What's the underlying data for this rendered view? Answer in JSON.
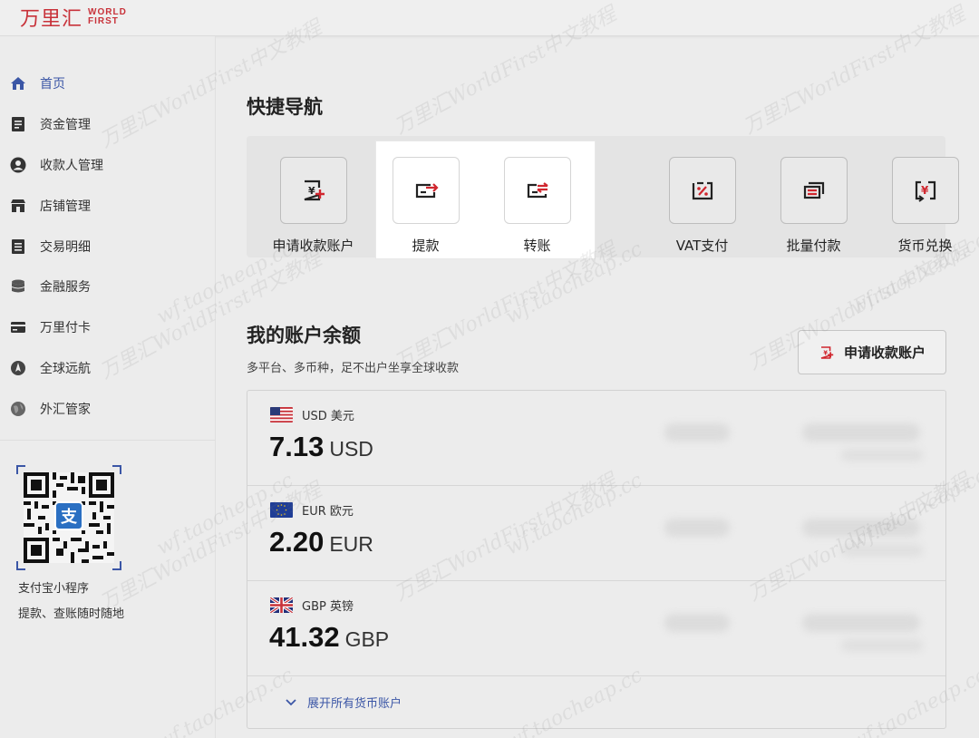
{
  "brand": {
    "logo_cn": "万里汇",
    "logo_en_line1": "WORLD",
    "logo_en_line2": "FIRST"
  },
  "sidebar": {
    "items": [
      {
        "label": "首页",
        "icon": "home-icon",
        "active": true
      },
      {
        "label": "资金管理",
        "icon": "document-icon",
        "active": false
      },
      {
        "label": "收款人管理",
        "icon": "user-icon",
        "active": false
      },
      {
        "label": "店铺管理",
        "icon": "store-icon",
        "active": false
      },
      {
        "label": "交易明细",
        "icon": "list-icon",
        "active": false
      },
      {
        "label": "金融服务",
        "icon": "database-icon",
        "active": false
      },
      {
        "label": "万里付卡",
        "icon": "card-icon",
        "active": false
      },
      {
        "label": "全球远航",
        "icon": "compass-icon",
        "active": false
      },
      {
        "label": "外汇管家",
        "icon": "globe-icon",
        "active": false
      }
    ],
    "qr_caption_1": "支付宝小程序",
    "qr_caption_2": "提款、查账随时随地",
    "qr_badge": "支"
  },
  "quick_nav": {
    "title": "快捷导航",
    "items": [
      {
        "label": "申请收款账户",
        "icon": "apply-account-icon"
      },
      {
        "label": "提款",
        "icon": "withdraw-icon"
      },
      {
        "label": "转账",
        "icon": "transfer-icon"
      },
      {
        "label": "VAT支付",
        "icon": "vat-payment-icon"
      },
      {
        "label": "批量付款",
        "icon": "batch-payment-icon"
      },
      {
        "label": "货币兑换",
        "icon": "currency-exchange-icon"
      }
    ]
  },
  "balance": {
    "title": "我的账户余额",
    "subtitle": "多平台、多币种，足不出户坐享全球收款",
    "apply_button": "申请收款账户",
    "accounts": [
      {
        "name": "USD 美元",
        "amount": "7.13",
        "currency": "USD",
        "flag": "us-flag-icon"
      },
      {
        "name": "EUR 欧元",
        "amount": "2.20",
        "currency": "EUR",
        "flag": "eu-flag-icon"
      },
      {
        "name": "GBP 英镑",
        "amount": "41.32",
        "currency": "GBP",
        "flag": "uk-flag-icon"
      }
    ],
    "expand_label": "展开所有货币账户"
  },
  "colors": {
    "brand_red": "#c8323a",
    "accent_blue": "#3b56a6"
  },
  "watermark": {
    "text_cn": "万里汇WorldFirst中文教程",
    "text_url": "wf.taocheap.cc"
  }
}
